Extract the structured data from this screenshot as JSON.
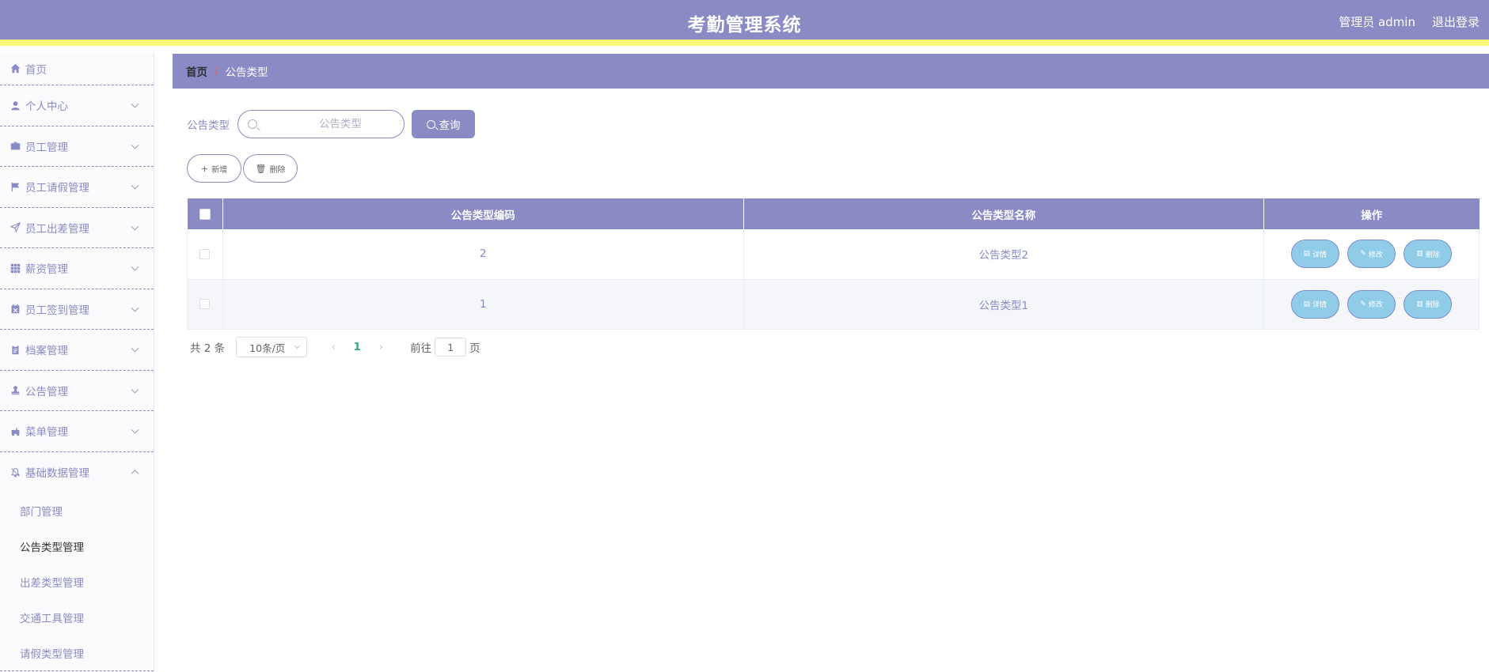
{
  "header": {
    "title": "考勤管理系统",
    "user": "管理员 admin",
    "logout": "退出登录"
  },
  "sidebar": {
    "items": [
      {
        "label": "首页",
        "icon": "home-icon"
      },
      {
        "label": "个人中心",
        "icon": "user-icon"
      },
      {
        "label": "员工管理",
        "icon": "briefcase-icon"
      },
      {
        "label": "员工请假管理",
        "icon": "flag-icon"
      },
      {
        "label": "员工出差管理",
        "icon": "send-icon"
      },
      {
        "label": "薪资管理",
        "icon": "grid-icon"
      },
      {
        "label": "员工签到管理",
        "icon": "calendar-icon"
      },
      {
        "label": "档案管理",
        "icon": "clipboard-icon"
      },
      {
        "label": "公告管理",
        "icon": "stamp-icon"
      },
      {
        "label": "菜单管理",
        "icon": "tractor-icon"
      },
      {
        "label": "基础数据管理",
        "icon": "bell-off-icon"
      }
    ],
    "submenu": [
      "部门管理",
      "公告类型管理",
      "出差类型管理",
      "交通工具管理",
      "请假类型管理"
    ]
  },
  "breadcrumb": {
    "home": "首页",
    "sep": "/",
    "current": "公告类型"
  },
  "search": {
    "label": "公告类型",
    "placeholder": "公告类型",
    "button": "查询"
  },
  "actions": {
    "add": "新增",
    "delete": "删除"
  },
  "table": {
    "columns": [
      "公告类型编码",
      "公告类型名称",
      "操作"
    ],
    "rows": [
      {
        "code": "2",
        "name": "公告类型2"
      },
      {
        "code": "1",
        "name": "公告类型1"
      }
    ],
    "ops": {
      "detail": "详情",
      "edit": "修改",
      "delete": "删除"
    }
  },
  "pager": {
    "total": "共 2 条",
    "size": "10条/页",
    "page": "1",
    "goto": "前往",
    "jump": "1",
    "unit": "页"
  },
  "colors": {
    "accent": "#8a8ac4",
    "stripe": "#f8f87a",
    "op_button": "#90cce8"
  }
}
